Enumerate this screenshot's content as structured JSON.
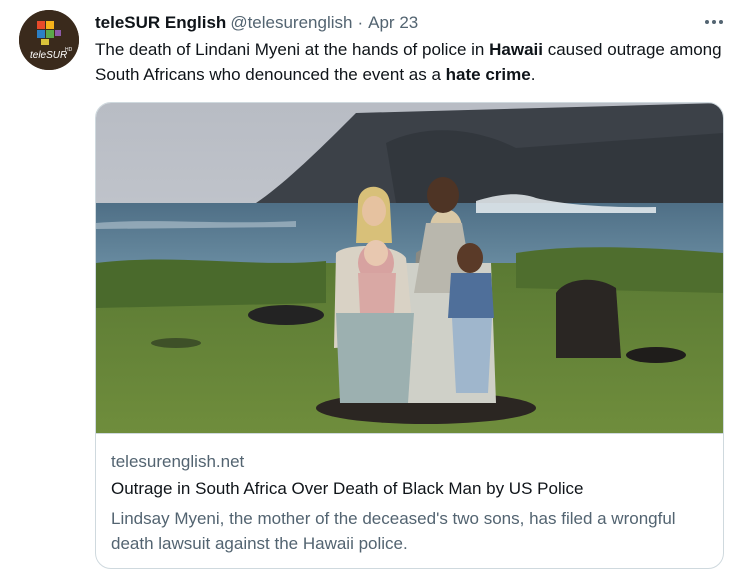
{
  "tweet": {
    "display_name": "teleSUR English",
    "handle": "@telesurenglish",
    "separator": "·",
    "date": "Apr 23",
    "text_parts": [
      "The death of Lindani Myeni at the hands of police in ",
      "Hawaii",
      " caused outrage among South Africans who denounced the event as a ",
      "hate crime",
      "."
    ],
    "avatar_logo_text": "teleSUR",
    "avatar_logo_sup": "HD"
  },
  "card": {
    "domain": "telesurenglish.net",
    "title": "Outrage in South Africa Over Death of Black Man by US Police",
    "description": "Lindsay Myeni, the mother of the deceased's two sons, has filed a wrongful death lawsuit against the Hawaii police."
  },
  "icons": {
    "more": "more-horizontal-icon"
  },
  "colors": {
    "text_primary": "#0f1419",
    "text_secondary": "#536471",
    "border": "#cfd9de"
  }
}
